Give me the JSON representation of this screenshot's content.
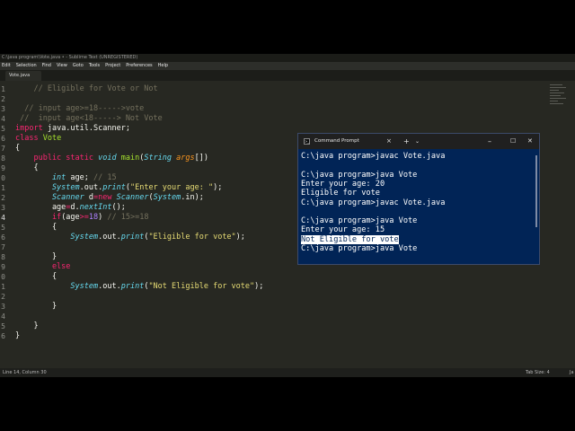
{
  "window": {
    "title": "C:\\java program\\Vote.java • - Sublime Text (UNREGISTERED)"
  },
  "menu": [
    "Edit",
    "Selection",
    "Find",
    "View",
    "Goto",
    "Tools",
    "Project",
    "Preferences",
    "Help"
  ],
  "tab": {
    "label": "Vote.java"
  },
  "gutter": [
    "1",
    "2",
    "3",
    "4",
    "5",
    "6",
    "7",
    "8",
    "9",
    "0",
    "1",
    "2",
    "3",
    "4",
    "5",
    "6",
    "7",
    "8",
    "9",
    "0",
    "1",
    "2",
    "3",
    "4",
    "5",
    "6"
  ],
  "code": {
    "l1": "    // Eligible for Vote or Not",
    "l3": "  // input age>=18----->vote",
    "l4": " //  input age<18-----> Not Vote",
    "l5_kw": "import",
    "l5_rest": " java.util.Scanner;",
    "l6_kw": "class",
    "l6_name": " Vote",
    "l7": "{",
    "l8_kw1": "    public",
    "l8_kw2": " static",
    "l8_ty": " void",
    "l8_fn": " main",
    "l8_p1": "(",
    "l8_ty2": "String",
    "l8_arg": " args",
    "l8_p2": "[])",
    "l9": "    {",
    "l10_ty": "        int",
    "l10_rest": " age; ",
    "l10_cm": "// 15",
    "l11_a": "        System",
    "l11_b": ".out.",
    "l11_c": "print",
    "l11_d": "(",
    "l11_s": "\"Enter your age: \"",
    "l11_e": ");",
    "l12_a": "        Scanner",
    "l12_b": " d",
    "l12_c": "=",
    "l12_d": "new",
    "l12_e": " Scanner",
    "l12_f": "(",
    "l12_g": "System",
    "l12_h": ".in);",
    "l13_a": "        age",
    "l13_b": "=",
    "l13_c": "d.",
    "l13_d": "nextInt",
    "l13_e": "();",
    "l14_kw": "        if",
    "l14_a": "(age",
    "l14_op": ">=",
    "l14_nu": "18",
    "l14_b": ") ",
    "l14_cm": "// 15>=18",
    "l15": "        {",
    "l16_a": "            System",
    "l16_b": ".out.",
    "l16_c": "print",
    "l16_d": "(",
    "l16_s": "\"Eligible for vote\"",
    "l16_e": ");",
    "l18": "        }",
    "l19_kw": "        else",
    "l20": "        {",
    "l21_a": "            System",
    "l21_b": ".out.",
    "l21_c": "print",
    "l21_d": "(",
    "l21_s": "\"Not Eligible for vote\"",
    "l21_e": ");",
    "l23": "        }",
    "l25": "    }",
    "l26": "}"
  },
  "status": {
    "position": "Line 14, Column 30",
    "tab_size": "Tab Size: 4",
    "language": "Ja"
  },
  "cmd": {
    "title": "Command Prompt",
    "tab_close": "×",
    "new_tab": "+",
    "dropdown": "⌄",
    "minimize": "–",
    "maximize": "☐",
    "close": "✕",
    "icon_text": ">_",
    "lines": [
      "C:\\java program>javac Vote.java",
      "",
      "C:\\java program>java Vote",
      "Enter your age: 20",
      "Eligible for vote",
      "C:\\java program>javac Vote.java",
      "",
      "C:\\java program>java Vote",
      "Enter your age: 15",
      "Not Eligible for vote",
      "C:\\java program>java Vote"
    ]
  }
}
